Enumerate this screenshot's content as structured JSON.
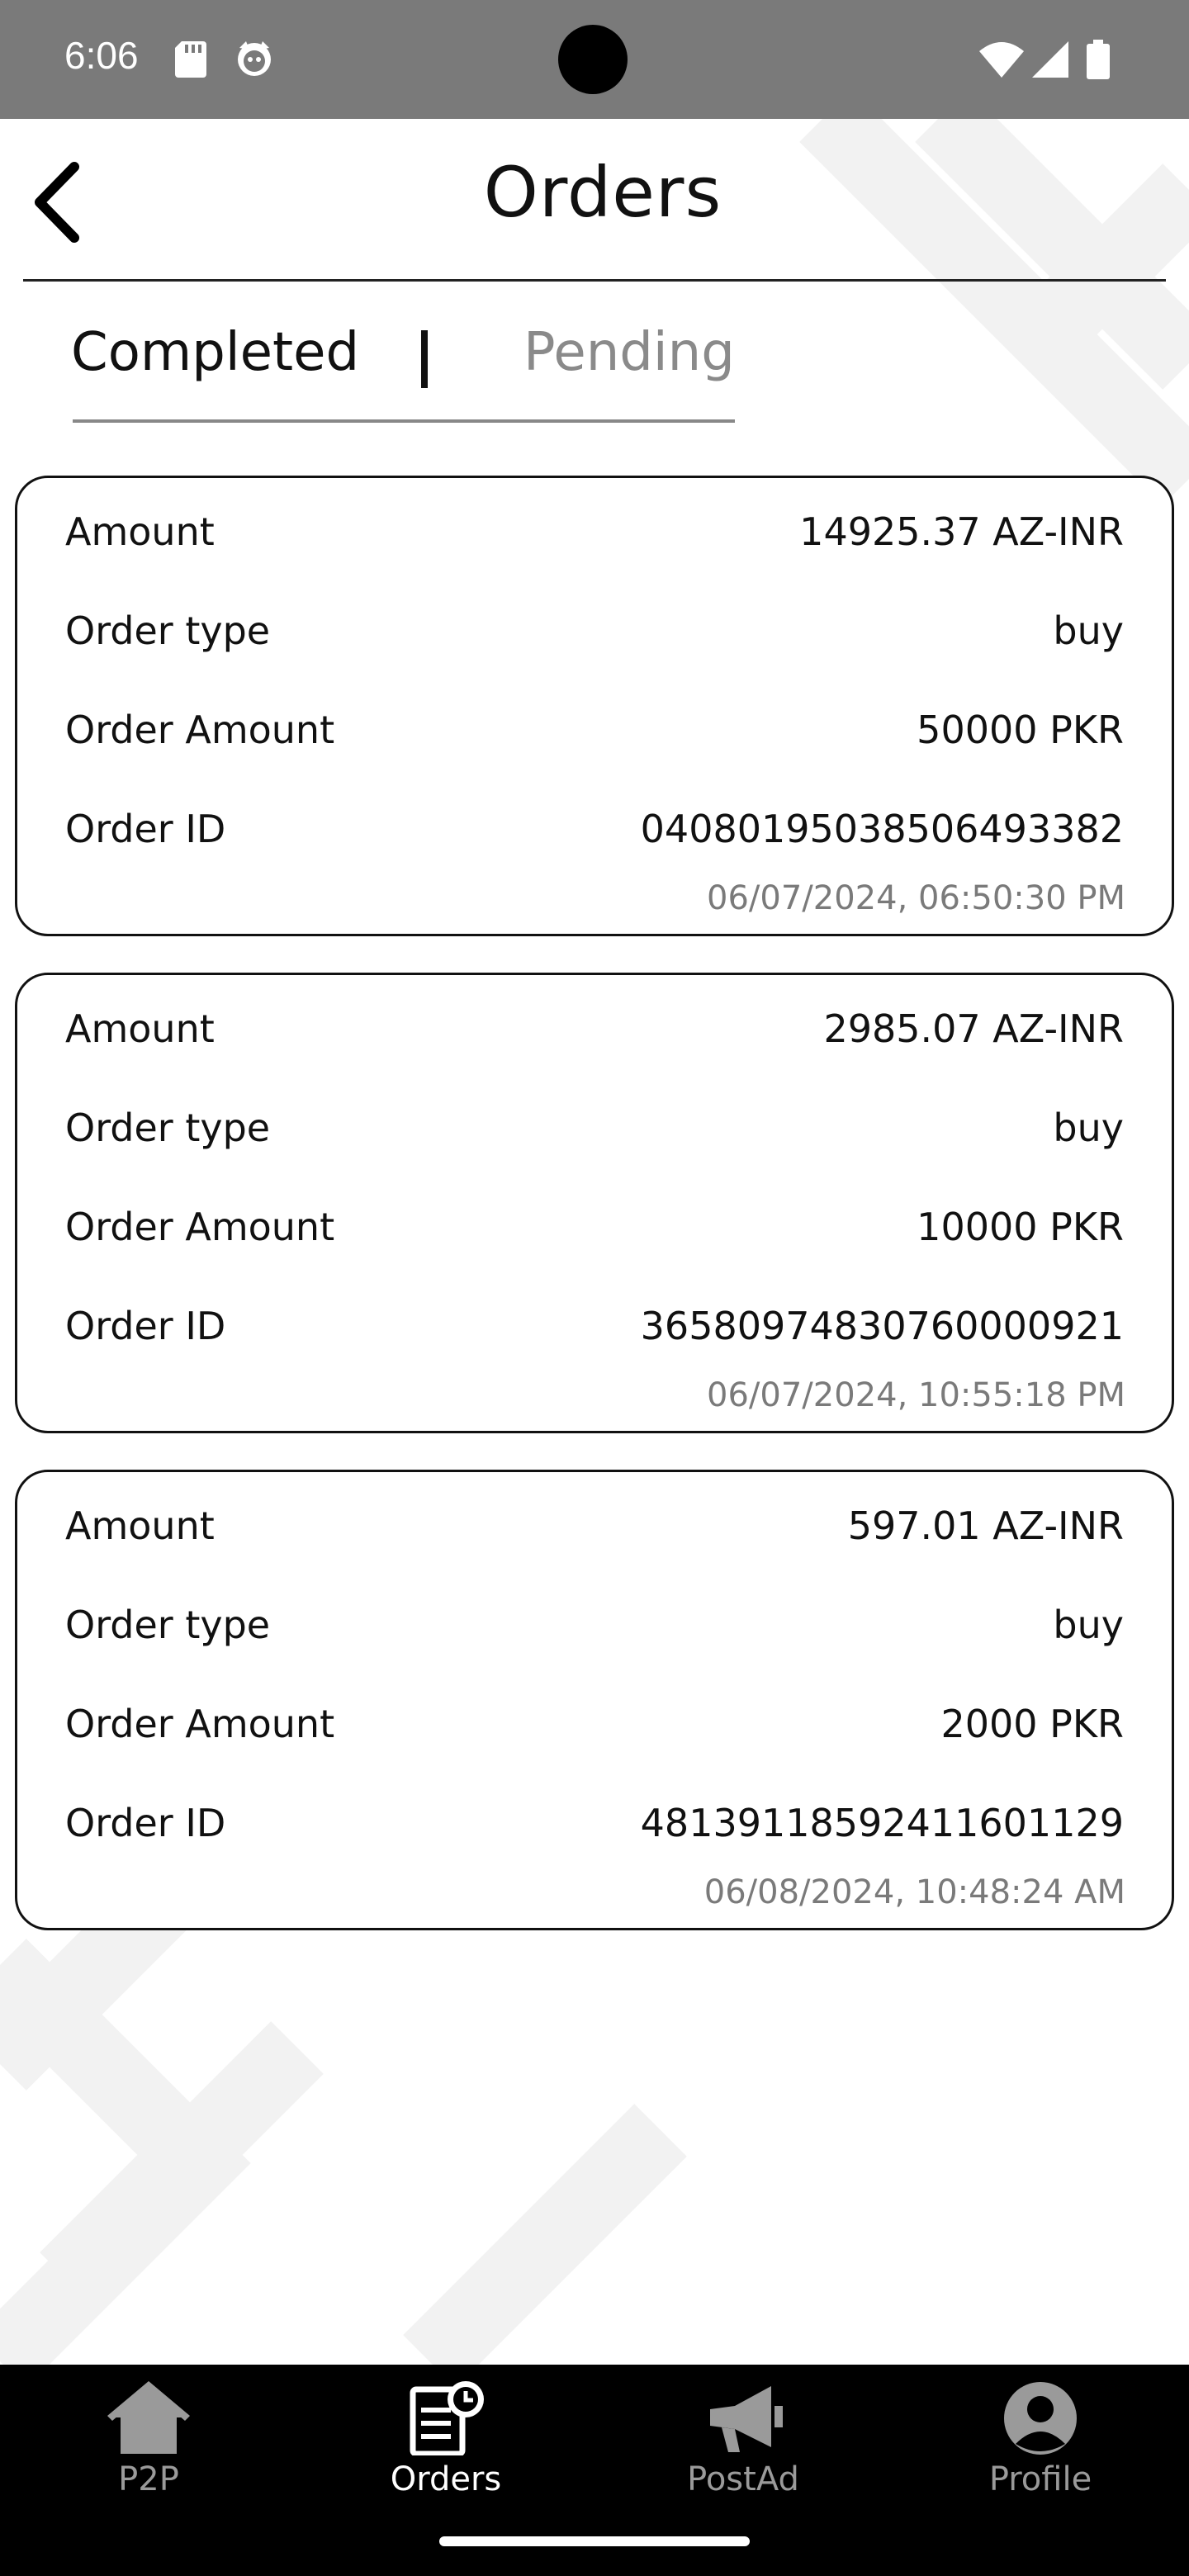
{
  "status_bar": {
    "time": "6:06",
    "icons": [
      "sd-card-icon",
      "cat-icon",
      "wifi-icon",
      "signal-icon",
      "battery-icon"
    ]
  },
  "header": {
    "title": "Orders",
    "back_icon": "back-chevron-icon"
  },
  "tabs": {
    "completed": "Completed",
    "pending": "Pending",
    "active": "Completed"
  },
  "orders": [
    {
      "amount_label": "Amount",
      "amount": "14925.37 AZ-INR",
      "order_type_label": "Order type",
      "order_type": "buy",
      "order_amount_label": "Order Amount",
      "order_amount": "50000 PKR",
      "order_id_label": "Order ID",
      "order_id": "04080195038506493382",
      "timestamp": "06/07/2024, 06:50:30 PM"
    },
    {
      "amount_label": "Amount",
      "amount": "2985.07 AZ-INR",
      "order_type_label": "Order type",
      "order_type": "buy",
      "order_amount_label": "Order Amount",
      "order_amount": "10000 PKR",
      "order_id_label": "Order ID",
      "order_id": "36580974830760000921",
      "timestamp": "06/07/2024, 10:55:18 PM"
    },
    {
      "amount_label": "Amount",
      "amount": "597.01 AZ-INR",
      "order_type_label": "Order type",
      "order_type": "buy",
      "order_amount_label": "Order Amount",
      "order_amount": "2000 PKR",
      "order_id_label": "Order ID",
      "order_id": "48139118592411601129",
      "timestamp": "06/08/2024, 10:48:24 AM"
    }
  ],
  "bottom_nav": {
    "items": [
      {
        "label": "P2P",
        "icon": "home-icon"
      },
      {
        "label": "Orders",
        "icon": "orders-clock-icon"
      },
      {
        "label": "PostAd",
        "icon": "megaphone-icon"
      },
      {
        "label": "Profile",
        "icon": "profile-icon"
      }
    ],
    "active": "Orders"
  },
  "colors": {
    "status_bar_bg": "#7a7a7a",
    "nav_bg": "#000000",
    "text": "#111111",
    "muted": "#8a8a8a",
    "timestamp": "#7a7a7a"
  }
}
